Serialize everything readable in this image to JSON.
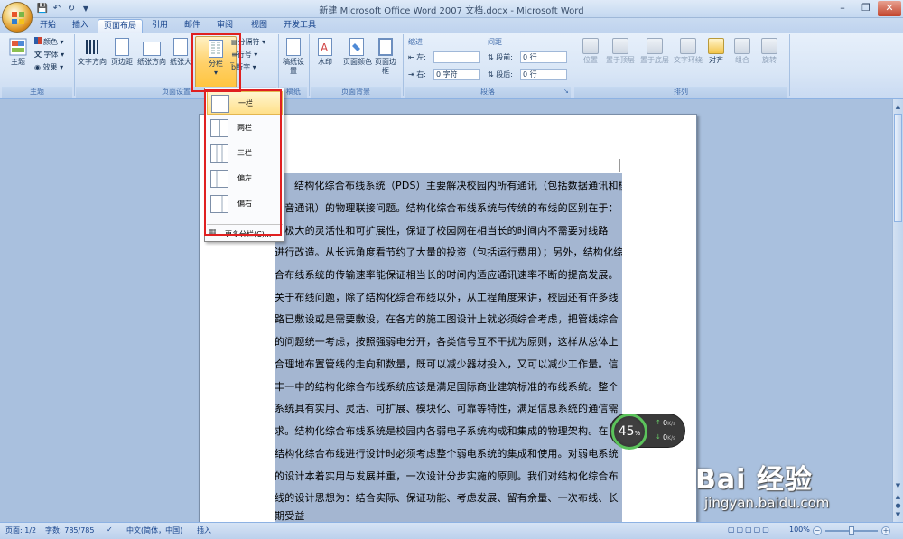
{
  "window": {
    "title": "新建 Microsoft Office Word 2007 文档.docx - Microsoft Word"
  },
  "tabs": [
    "开始",
    "插入",
    "页面布局",
    "引用",
    "邮件",
    "审阅",
    "视图",
    "开发工具"
  ],
  "ribbon": {
    "theme_group": {
      "label": "主题",
      "themes_button": "主题",
      "colors": "颜色",
      "fonts": "字体",
      "effects": "效果"
    },
    "page_setup_group": {
      "label": "页面设置",
      "text_direction": "文字方向",
      "margins": "页边距",
      "orientation": "纸张方向",
      "size": "纸张大小",
      "columns": "分栏",
      "breaks": "分隔符",
      "line_numbers": "行号",
      "hyphenation": "断字"
    },
    "manuscript_group": {
      "label": "稿纸",
      "manuscript_settings": "稿纸设置"
    },
    "page_background_group": {
      "label": "页面背景",
      "watermark": "水印",
      "page_color": "页面颜色",
      "page_borders": "页面边框"
    },
    "paragraph_group": {
      "label": "段落",
      "indent_title": "缩进",
      "indent_left_label": "左:",
      "indent_left_value": "",
      "indent_right_label": "右:",
      "indent_right_value": "0 字符",
      "spacing_title": "间距",
      "spacing_before_label": "段前:",
      "spacing_before_value": "0 行",
      "spacing_after_label": "段后:",
      "spacing_after_value": "0 行"
    },
    "arrange_group": {
      "label": "排列",
      "position": "位置",
      "bring_front": "置于顶层",
      "send_back": "置于底层",
      "text_wrap": "文字环绕",
      "align": "对齐",
      "group": "组合",
      "rotate": "旋转"
    }
  },
  "columns_menu": {
    "items": [
      "一栏",
      "两栏",
      "三栏",
      "偏左",
      "偏右"
    ],
    "more": "更多分栏(C)..."
  },
  "document": {
    "lines": [
      "结构化综合布线系统（PDS）主要解决校园内所有通讯（包括数据通讯和模",
      "语音通讯）的物理联接问题。结构化综合布线系统与传统的布线的区别在于：",
      "有极大的灵活性和可扩展性，保证了校园网在相当长的时间内不需要对线路",
      "进行改造。从长远角度看节约了大量的投资（包括运行费用）；另外，结构化综",
      "合布线系统的传输速率能保证相当长的时间内适应通讯速率不断的提高发展。",
      "关于布线问题，除了结构化综合布线以外，从工程角度来讲，校园还有许多线",
      "路已敷设或是需要敷设，在各方的施工图设计上就必须综合考虑，把管线综合",
      "的问题统一考虑，按照强弱电分开，各类信号互不干扰为原则，这样从总体上",
      "合理地布置管线的走向和数量，既可以减少器材投入，又可以减少工作量。信",
      "丰一中的结构化综合布线系统应该是满足国际商业建筑标准的布线系统。整个",
      "系统具有实用、灵活、可扩展、模块化、可靠等特性，满足信息系统的通信需",
      "求。结构化综合布线系统是校园内各弱电子系统构成和集成的物理架构。在",
      "结构化综合布线进行设计时必须考虑整个弱电系统的集成和使用。对弱电系统",
      "的设计本着实用与发展并重，一次设计分步实施的原则。我们对结构化综合布",
      "线的设计思想为：结合实际、保证功能、考虑发展、留有余量、一次布线、长",
      "期受益"
    ]
  },
  "status_bar": {
    "page": "页面: 1/2",
    "words": "字数: 785/785",
    "language": "中文(简体，中国)",
    "insert_mode": "插入",
    "zoom": "100%"
  },
  "speed_widget": {
    "percent": "45",
    "percent_unit": "%",
    "up": "0",
    "up_unit": "K/s",
    "down": "0",
    "down_unit": "K/s"
  },
  "watermark": {
    "logo": "Bai 经验",
    "url": "jingyan.baidu.com"
  }
}
